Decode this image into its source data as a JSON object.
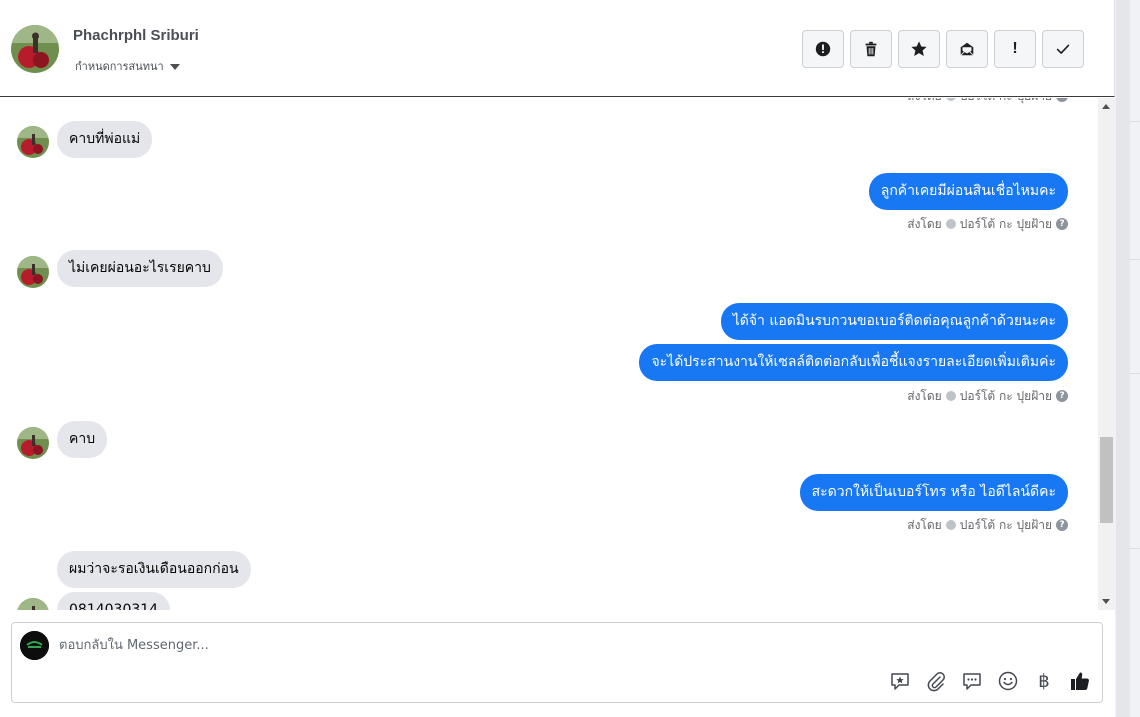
{
  "header": {
    "contact_name": "Phachrphl Sriburi",
    "assign_label": "กำหนดการสนทนา",
    "toolbar": [
      {
        "icon": "alert-circle-icon"
      },
      {
        "icon": "trash-icon"
      },
      {
        "icon": "star-icon"
      },
      {
        "icon": "move-to-inbox-icon"
      },
      {
        "icon": "exclamation-icon",
        "glyph": "!"
      },
      {
        "icon": "checkmark-icon"
      }
    ]
  },
  "thread": {
    "sent_by_label": "ส่งโดย",
    "sender_name": "ปอร์โต้ กะ ปุยฝ้าย",
    "messages": [
      {
        "dir": "in",
        "text": "คาบที่พ่อแม่"
      },
      {
        "dir": "out",
        "text": "ลูกค้าเคยมีผ่อนสินเชื่อไหมคะ"
      },
      {
        "dir": "in",
        "text": "ไม่เคยผ่อนอะไรเรยคาบ"
      },
      {
        "dir": "out",
        "text": "ได้จ้า แอดมินรบกวนขอเบอร์ติดต่อคุณลูกค้าด้วยนะคะ"
      },
      {
        "dir": "out",
        "text": "จะได้ประสานงานให้เซลล์ติดต่อกลับเพื่อชี้แจงรายละเอียดเพิ่มเติมค่ะ"
      },
      {
        "dir": "in",
        "text": "คาบ"
      },
      {
        "dir": "out",
        "text": "สะดวกให้เป็นเบอร์โทร หรือ ไอดีไลน์ดีคะ"
      },
      {
        "dir": "in",
        "text": "ผมว่าจะรอเงินเดือนออกก่อน"
      },
      {
        "dir": "in",
        "text": "0814030314"
      }
    ]
  },
  "composer": {
    "placeholder": "ตอบกลับใน Messenger...",
    "tools": [
      "saved-reply-icon",
      "attachment-icon",
      "chat-bubble-icon",
      "emoji-icon",
      "baht-payment-icon",
      "thumbs-up-icon"
    ],
    "baht_glyph": "฿"
  },
  "colors": {
    "outgoing_bubble": "#1877f2",
    "incoming_bubble": "#e4e6eb",
    "like_button": "#1c1e21"
  }
}
